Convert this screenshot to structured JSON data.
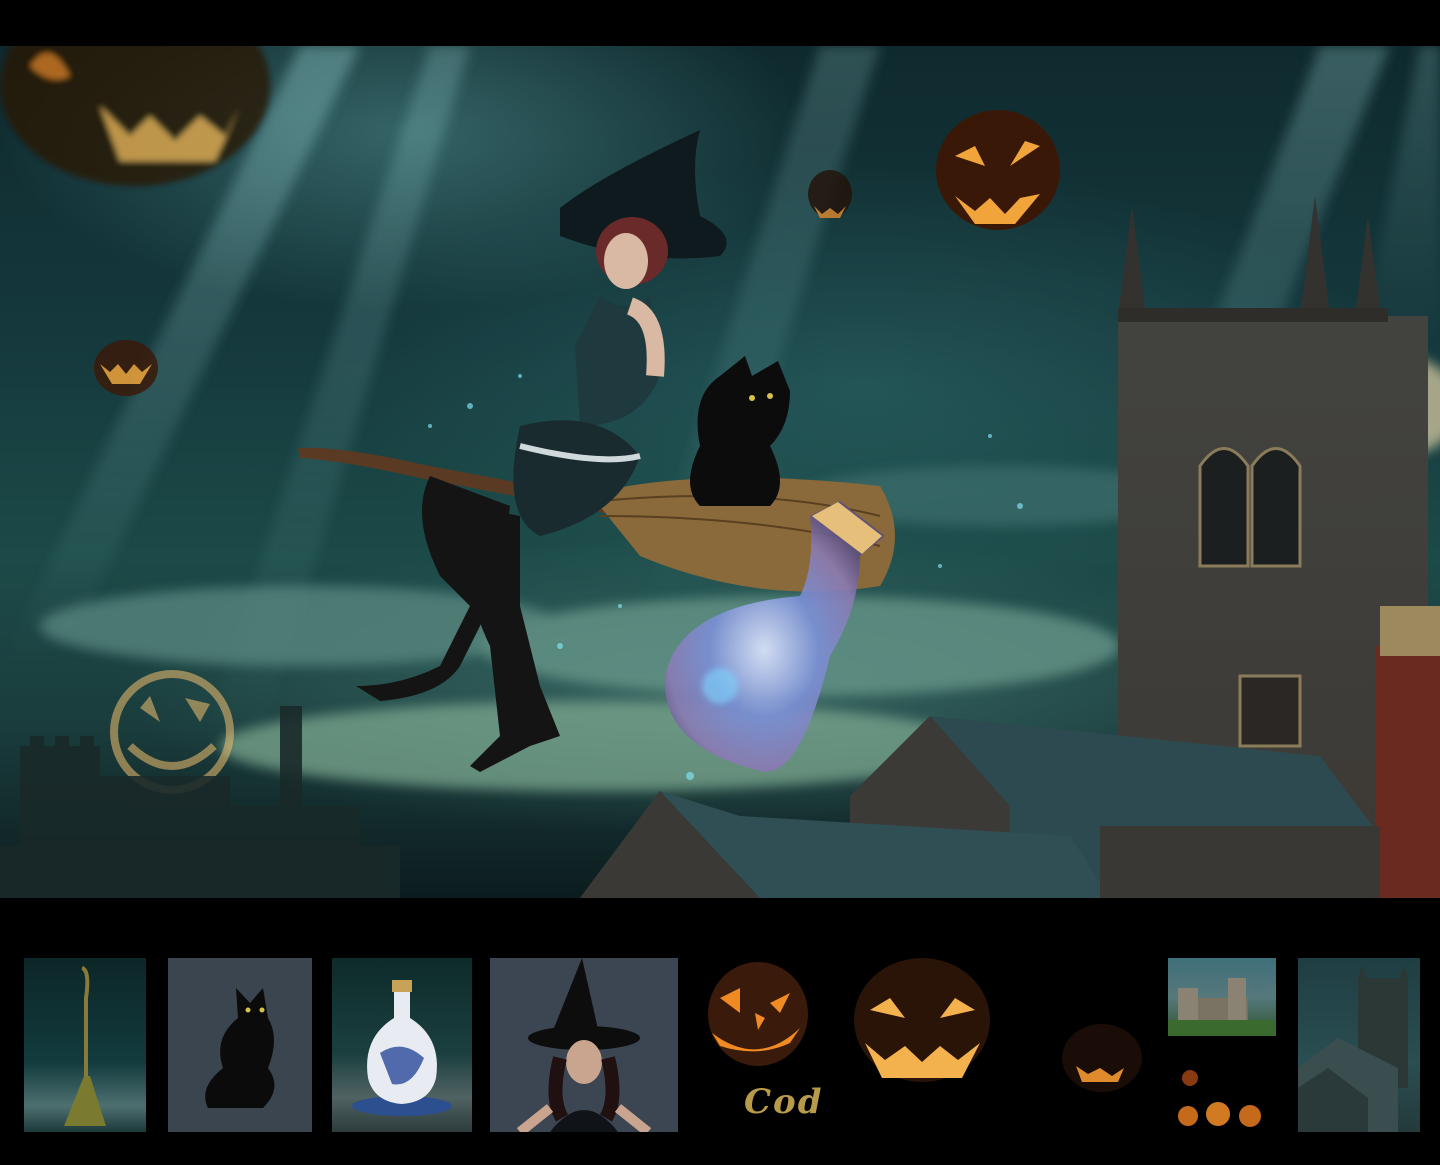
{
  "strip_signature": "Cod",
  "colors": {
    "sky_dark": "#0f2a2e",
    "sky_teal": "#1c4a48",
    "pumpkin_glow": "#f0a43a",
    "pumpkin_body": "#3a1a08",
    "stone": "#3d3a36",
    "roof": "#2c4a4f"
  }
}
